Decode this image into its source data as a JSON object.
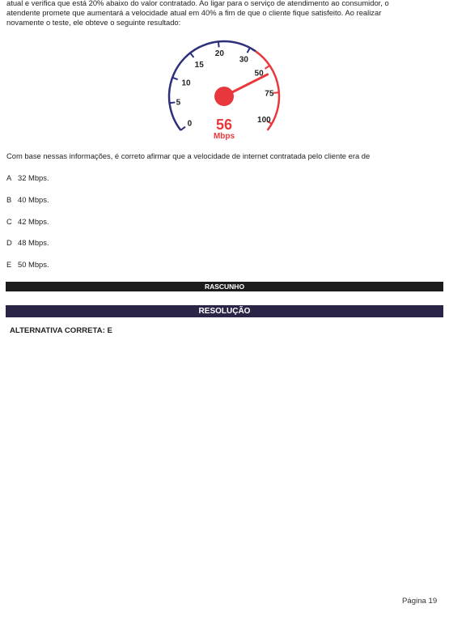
{
  "intro": {
    "line1": "atual e verifica que está 20% abaixo do valor contratado. Ao ligar para o serviço de atendimento ao consumidor, o",
    "line2": "atendente promete que aumentará a velocidade atual em 40% a fim de que o cliente fique satisfeito. Ao realizar",
    "line3": "novamente o teste, ele obteve o seguinte resultado:"
  },
  "gauge": {
    "value": "56",
    "unit": "Mbps",
    "needle_value": 56,
    "scale_labels": [
      "0",
      "5",
      "10",
      "15",
      "20",
      "30",
      "50",
      "75",
      "100"
    ],
    "colors": {
      "blue_arc": "#2d2f7a",
      "red_arc": "#e8383d",
      "needle": "#e8383d"
    }
  },
  "question": "Com base nessas informações, é correto afirmar que a velocidade de internet contratada pelo cliente era de",
  "options": [
    {
      "letter": "A",
      "text": "32 Mbps."
    },
    {
      "letter": "B",
      "text": "40 Mbps."
    },
    {
      "letter": "C",
      "text": "42 Mbps."
    },
    {
      "letter": "D",
      "text": "48 Mbps."
    },
    {
      "letter": "E",
      "text": "50 Mbps."
    }
  ],
  "rascunho_label": "RASCUNHO",
  "resolucao_label": "RESOLUÇÃO",
  "answer": "ALTERNATIVA CORRETA: E",
  "page_number": "Página 19"
}
